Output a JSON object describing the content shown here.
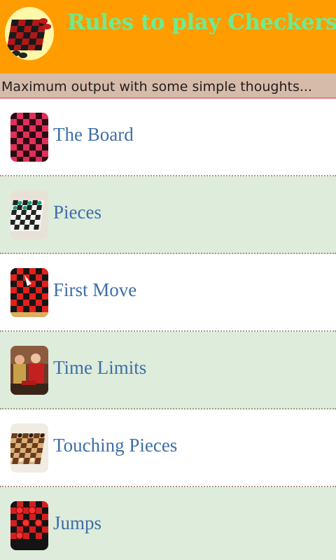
{
  "header": {
    "title": "Rules to play Checkers",
    "logo_icon": "checkerboard-logo-icon",
    "background": "#ff9c00",
    "title_color": "#6eeb8f"
  },
  "tagline": "Maximum output with some simple thoughts...",
  "list": {
    "items": [
      {
        "label": "The Board",
        "icon": "checkerboard-thumbnail-icon"
      },
      {
        "label": "Pieces",
        "icon": "checkers-pieces-thumbnail-icon"
      },
      {
        "label": "First Move",
        "icon": "red-checkerboard-thumbnail-icon"
      },
      {
        "label": "Time Limits",
        "icon": "players-photo-thumbnail-icon"
      },
      {
        "label": "Touching Pieces",
        "icon": "wooden-checkers-thumbnail-icon"
      },
      {
        "label": "Jumps",
        "icon": "red-pieces-thumbnail-icon"
      }
    ]
  }
}
